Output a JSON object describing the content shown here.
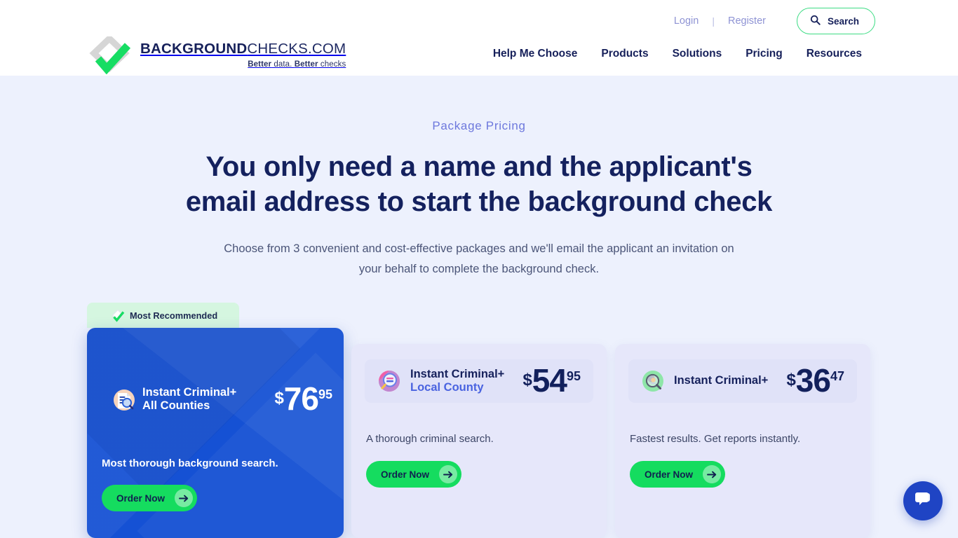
{
  "header": {
    "logo": {
      "brand_bold": "BACKGROUND",
      "brand_light": "CHECKS.COM",
      "tagline_b1": "Better",
      "tagline_t1": " data. ",
      "tagline_b2": "Better",
      "tagline_t2": " checks",
      "mark_icon": "diamond-check-logo-icon"
    },
    "top_links": [
      {
        "label": "Login"
      },
      {
        "label": "Register"
      }
    ],
    "separator": "|",
    "search": {
      "label": "Search",
      "icon": "search-icon"
    },
    "nav": [
      {
        "label": "Help Me Choose"
      },
      {
        "label": "Products"
      },
      {
        "label": "Solutions"
      },
      {
        "label": "Pricing"
      },
      {
        "label": "Resources"
      }
    ]
  },
  "hero": {
    "eyebrow": "Package Pricing",
    "title_line1": "You only need a name and the applicant's",
    "title_line2": "email address to start the background check",
    "subtitle": "Choose from 3 convenient and cost-effective packages and we'll email the applicant an invitation on your behalf to complete the background check."
  },
  "badge": {
    "label": "Most Recommended",
    "icon": "diamond-check-icon"
  },
  "packages": [
    {
      "name_line1": "Instant Criminal+",
      "name_line2": "All Counties",
      "icon": "document-magnifier-icon",
      "currency": "$",
      "price": "76",
      "cents": "95",
      "description": "Most thorough background search.",
      "cta": "Order Now",
      "cta_icon": "arrow-right-icon",
      "featured": true
    },
    {
      "name_line1": "Instant Criminal+",
      "name_line2": "Local County",
      "icon": "pink-magnifier-icon",
      "currency": "$",
      "price": "54",
      "cents": "95",
      "description": "A thorough criminal search.",
      "cta": "Order Now",
      "cta_icon": "arrow-right-icon",
      "featured": false
    },
    {
      "name_line1": "Instant Criminal+",
      "name_line2": "",
      "icon": "green-magnifier-person-icon",
      "currency": "$",
      "price": "36",
      "cents": "47",
      "description": "Fastest results. Get reports instantly.",
      "cta": "Order Now",
      "cta_icon": "arrow-right-icon",
      "featured": false
    }
  ],
  "chat": {
    "icon": "chat-bubbles-icon"
  },
  "colors": {
    "page_bg": "#edf1fd",
    "navy": "#14215e",
    "brand_blue": "#1551d4",
    "accent_green": "#15dc5f",
    "badge_bg": "#d5f6e0",
    "card_bg": "#e6e7fa",
    "eyebrow": "#6d78dd",
    "link_muted": "#8e93d4"
  }
}
